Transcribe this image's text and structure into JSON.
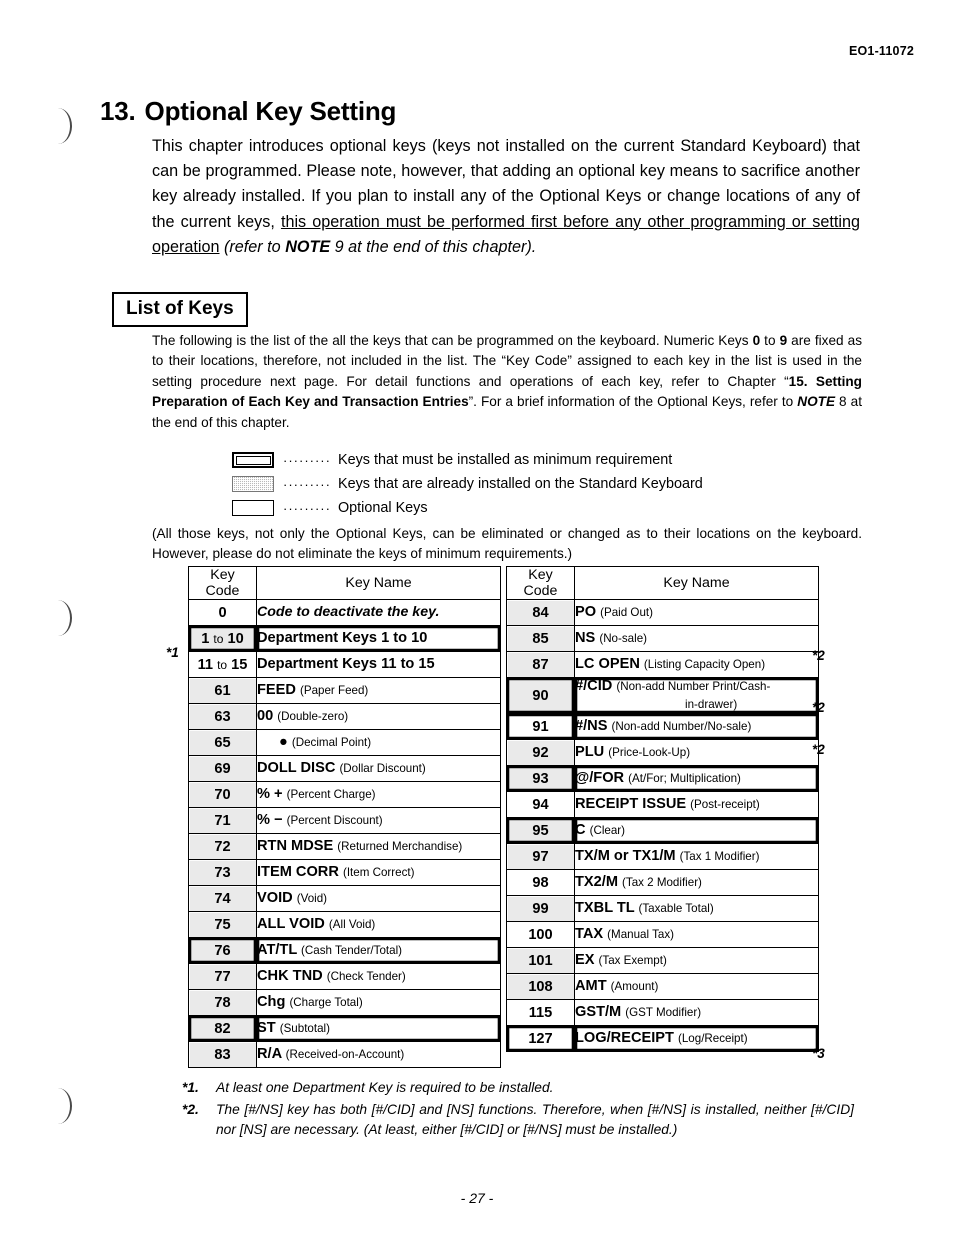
{
  "document": {
    "doc_code": "EO1-11072",
    "page_number": "- 27 -"
  },
  "chapter": {
    "number": "13.",
    "title": "Optional Key Setting",
    "intro_p1": "This chapter introduces optional keys (keys not installed on the current Standard Keyboard) that can be programmed.  Please note, however, that adding an optional key means to sacrifice another key already installed.  If you plan to install any of the Optional Keys or change locations of any of the current keys, ",
    "intro_underlined": "this operation must be performed first before any other programming or setting operation",
    "intro_tail_1": " (refer to ",
    "intro_note_bold": "NOTE",
    "intro_tail_2": " 9 at the end of this chapter)."
  },
  "section": {
    "heading": "List of Keys",
    "explain_1": "The following is the list of the all the keys that can be programmed on the keyboard.  Numeric Keys ",
    "explain_bold_0": "0",
    "explain_2": " to ",
    "explain_bold_9": "9",
    "explain_3": " are fixed as to their locations, therefore, not included in the list.  The “Key Code” assigned to each key in the list is used in the setting procedure next page.  For detail functions and operations of each key, refer to Chapter “",
    "explain_bold_ch": "15. Setting Preparation of Each Key and Transaction Entries",
    "explain_4": "”.  For a brief information of the Optional Keys, refer to ",
    "explain_note": "NOTE",
    "explain_5": " 8 at the end of this chapter.",
    "note_para": "(All those keys, not only the Optional Keys, can be eliminated or changed as to their locations on the keyboard.  However, please do not eliminate the keys of minimum requirements.)"
  },
  "legend": {
    "dots": "·········",
    "items": [
      {
        "style": "minimum",
        "text": "Keys that must be installed as minimum requirement"
      },
      {
        "style": "installed",
        "text": "Keys that are already installed on the Standard Keyboard"
      },
      {
        "style": "optional",
        "text": "Optional Keys"
      }
    ]
  },
  "table": {
    "headers": {
      "code": "Key\nCode",
      "code_line1": "Key",
      "code_line2": "Code",
      "name": "Key Name"
    },
    "left_rows": [
      {
        "code": "0",
        "name_bold": "",
        "name_italic": "Code to deactivate the key.",
        "paren": "",
        "shaded": false,
        "minreq": false
      },
      {
        "code": "1 to 10",
        "code_small_to": true,
        "name_bold": "Department Keys 1 to 10",
        "paren": "",
        "shaded": true,
        "minreq": true
      },
      {
        "code": "11 to 15",
        "code_small_to": true,
        "name_bold": "Department Keys 11 to 15",
        "paren": "",
        "shaded": false,
        "minreq": false
      },
      {
        "code": "61",
        "name_bold": "FEED",
        "paren": "(Paper Feed)",
        "shaded": true,
        "minreq": false
      },
      {
        "code": "63",
        "name_bold": "00",
        "paren": "(Double-zero)",
        "shaded": true,
        "minreq": false
      },
      {
        "code": "65",
        "name_bold": "●",
        "paren": "(Decimal Point)",
        "indent": true,
        "shaded": true,
        "minreq": false
      },
      {
        "code": "69",
        "name_bold": "DOLL DISC",
        "paren": "(Dollar Discount)",
        "shaded": true,
        "minreq": false
      },
      {
        "code": "70",
        "name_bold": "% +",
        "paren": "(Percent Charge)",
        "shaded": true,
        "minreq": false
      },
      {
        "code": "71",
        "name_bold": "% −",
        "paren": "(Percent Discount)",
        "shaded": true,
        "minreq": false
      },
      {
        "code": "72",
        "name_bold": "RTN MDSE",
        "paren": "(Returned Merchandise)",
        "shaded": true,
        "minreq": false
      },
      {
        "code": "73",
        "name_bold": "ITEM CORR",
        "paren": "(Item Correct)",
        "shaded": true,
        "minreq": false
      },
      {
        "code": "74",
        "name_bold": "VOID",
        "paren": "(Void)",
        "shaded": true,
        "minreq": false
      },
      {
        "code": "75",
        "name_bold": "ALL VOID",
        "paren": "(All Void)",
        "shaded": true,
        "minreq": false
      },
      {
        "code": "76",
        "name_bold": "AT/TL",
        "paren": "(Cash Tender/Total)",
        "shaded": true,
        "minreq": true
      },
      {
        "code": "77",
        "name_bold": "CHK TND",
        "paren": "(Check Tender)",
        "shaded": true,
        "minreq": false
      },
      {
        "code": "78",
        "name_bold": "Chg",
        "paren": "(Charge Total)",
        "shaded": true,
        "minreq": false
      },
      {
        "code": "82",
        "name_bold": "ST",
        "paren": "(Subtotal)",
        "shaded": true,
        "minreq": true
      },
      {
        "code": "83",
        "name_bold": "R/A",
        "paren": "(Received-on-Account)",
        "shaded": true,
        "minreq": false
      }
    ],
    "right_rows": [
      {
        "code": "84",
        "name_bold": "PO",
        "paren": "(Paid Out)",
        "shaded": true,
        "minreq": false
      },
      {
        "code": "85",
        "name_bold": "NS",
        "paren": "(No-sale)",
        "shaded": true,
        "minreq": false
      },
      {
        "code": "87",
        "name_bold": "LC OPEN",
        "paren": "(Listing Capacity Open)",
        "shaded": true,
        "minreq": false
      },
      {
        "code": "90",
        "name_bold": "#/CID",
        "paren": "(Non-add Number Print/Cash-",
        "paren2": "in-drawer)",
        "shaded": true,
        "minreq": true
      },
      {
        "code": "91",
        "name_bold": "#/NS",
        "paren": "(Non-add Number/No-sale)",
        "shaded": false,
        "minreq": true
      },
      {
        "code": "92",
        "name_bold": "PLU",
        "paren": "(Price-Look-Up)",
        "shaded": true,
        "minreq": false
      },
      {
        "code": "93",
        "name_bold": "@/FOR",
        "paren": "(At/For; Multiplication)",
        "shaded": true,
        "minreq": true
      },
      {
        "code": "94",
        "name_bold": "RECEIPT ISSUE",
        "paren": "(Post-receipt)",
        "shaded": false,
        "minreq": false
      },
      {
        "code": "95",
        "name_bold": "C",
        "paren": "(Clear)",
        "shaded": true,
        "minreq": true
      },
      {
        "code": "97",
        "name_bold": "TX/M or TX1/M",
        "paren": "(Tax 1 Modifier)",
        "shaded": true,
        "minreq": false
      },
      {
        "code": "98",
        "name_bold": "TX2/M",
        "paren": "(Tax 2 Modifier)",
        "shaded": false,
        "minreq": false
      },
      {
        "code": "99",
        "name_bold": "TXBL TL",
        "paren": "(Taxable Total)",
        "shaded": true,
        "minreq": false
      },
      {
        "code": "100",
        "name_bold": "TAX",
        "paren": "(Manual Tax)",
        "shaded": false,
        "minreq": false
      },
      {
        "code": "101",
        "name_bold": "EX",
        "paren": "(Tax Exempt)",
        "shaded": true,
        "minreq": false
      },
      {
        "code": "108",
        "name_bold": "AMT",
        "paren": "(Amount)",
        "shaded": true,
        "minreq": false
      },
      {
        "code": "115",
        "name_bold": "GST/M",
        "paren": "(GST Modifier)",
        "shaded": false,
        "minreq": false
      },
      {
        "code": "127",
        "name_bold": "LOG/RECEIPT",
        "paren": "(Log/Receipt)",
        "shaded": false,
        "minreq": true
      }
    ]
  },
  "markers": {
    "m1": "*1",
    "m2a": "*2",
    "m2b": "*2",
    "m2c": "*2",
    "m3": "*3"
  },
  "footnotes": [
    {
      "label": "*1.",
      "text": "At least one Department Key is required to be installed."
    },
    {
      "label": "*2.",
      "text": "The [#/NS] key has both [#/CID] and [NS] functions.  Therefore, when [#/NS] is installed, neither [#/CID] nor [NS] are necessary.  (At least, either [#/CID] or [#/NS] must be installed.)"
    }
  ]
}
